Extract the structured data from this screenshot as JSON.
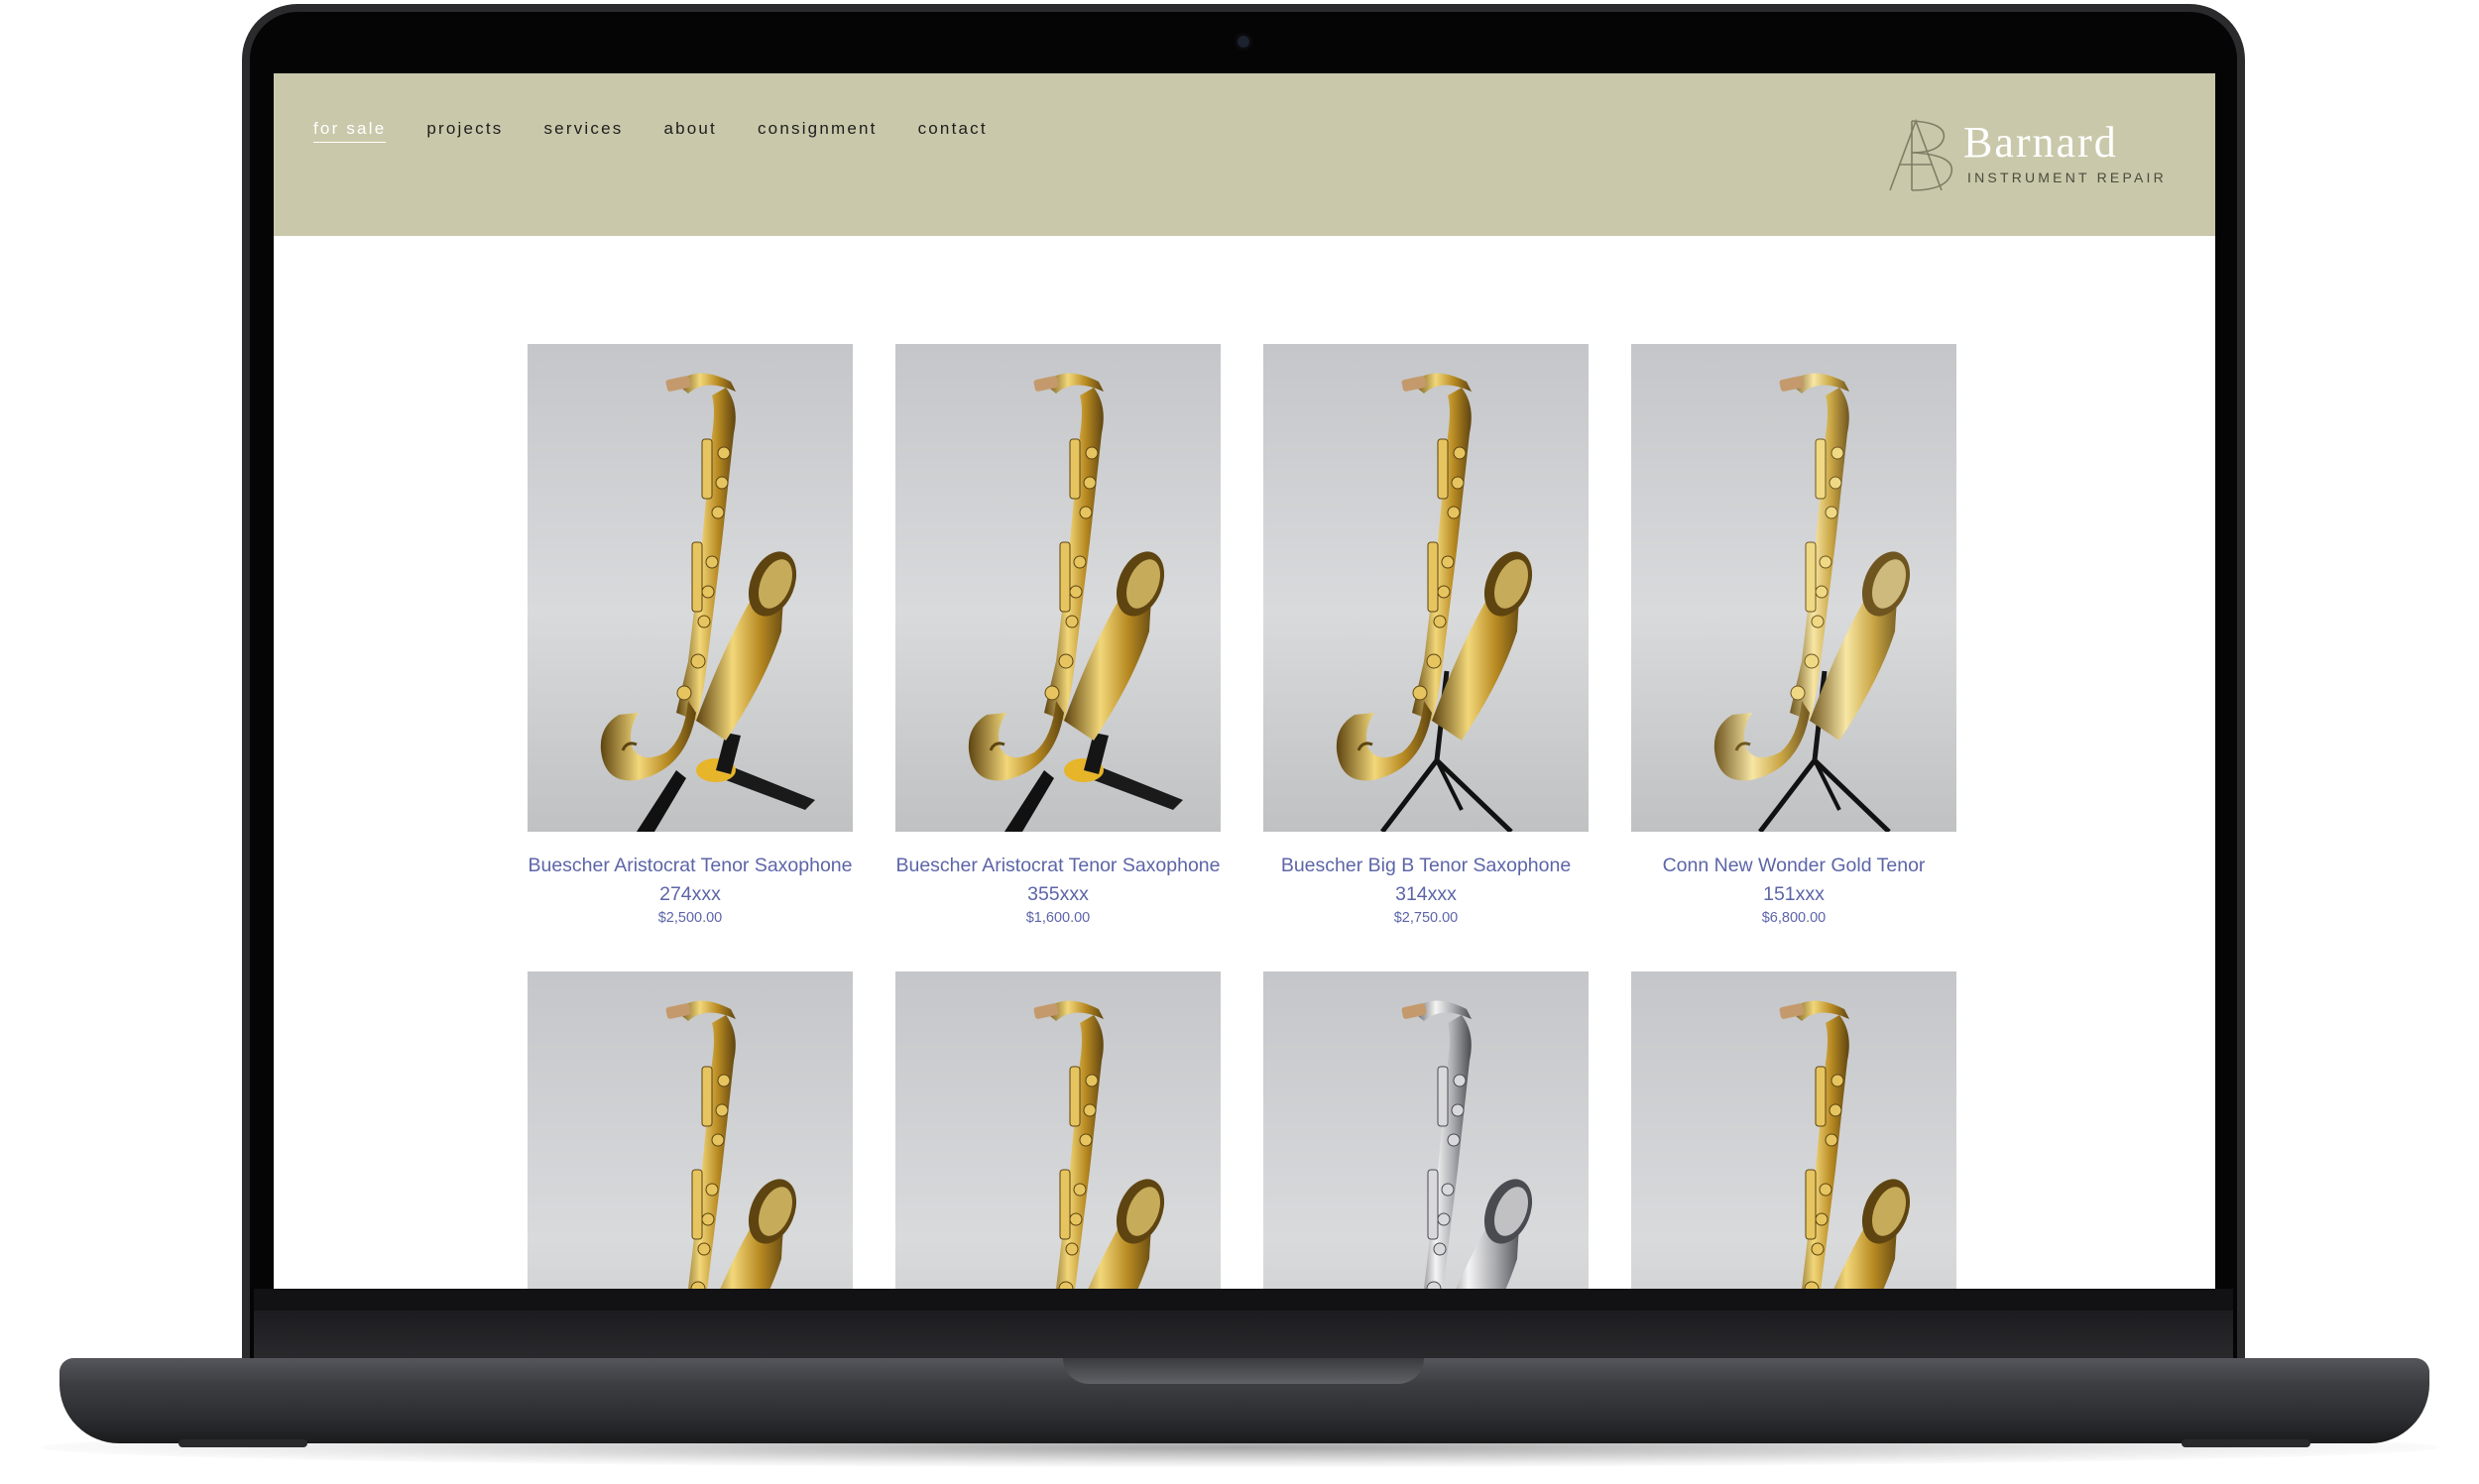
{
  "colors": {
    "header_bg": "#c9c8aa",
    "link_color": "#5d65a8",
    "active_nav": "#ffffff",
    "page_bg": "#ffffff"
  },
  "nav": {
    "items": [
      {
        "label": "for sale",
        "active": true
      },
      {
        "label": "projects",
        "active": false
      },
      {
        "label": "services",
        "active": false
      },
      {
        "label": "about",
        "active": false
      },
      {
        "label": "consignment",
        "active": false
      },
      {
        "label": "contact",
        "active": false
      }
    ]
  },
  "logo": {
    "title": "Barnard",
    "subtitle": "INSTRUMENT REPAIR",
    "icon": "ab-monogram-icon"
  },
  "products": [
    {
      "title": "Buescher Aristocrat Tenor Saxophone 274xxx",
      "price": "$2,500.00",
      "finish": "lacquer",
      "stand": "yellow-black"
    },
    {
      "title": "Buescher Aristocrat Tenor Saxophone 355xxx",
      "price": "$1,600.00",
      "finish": "lacquer",
      "stand": "yellow-black"
    },
    {
      "title": "Buescher Big B Tenor Saxophone 314xxx",
      "price": "$2,750.00",
      "finish": "lacquer",
      "stand": "tripod"
    },
    {
      "title": "Conn New Wonder Gold Tenor 151xxx",
      "price": "$6,800.00",
      "finish": "gold",
      "stand": "tripod"
    },
    {
      "title": "",
      "price": "",
      "finish": "lacquer",
      "stand": "none"
    },
    {
      "title": "",
      "price": "",
      "finish": "lacquer",
      "stand": "none"
    },
    {
      "title": "",
      "price": "",
      "finish": "silver",
      "stand": "none"
    },
    {
      "title": "",
      "price": "",
      "finish": "lacquer",
      "stand": "none"
    }
  ]
}
